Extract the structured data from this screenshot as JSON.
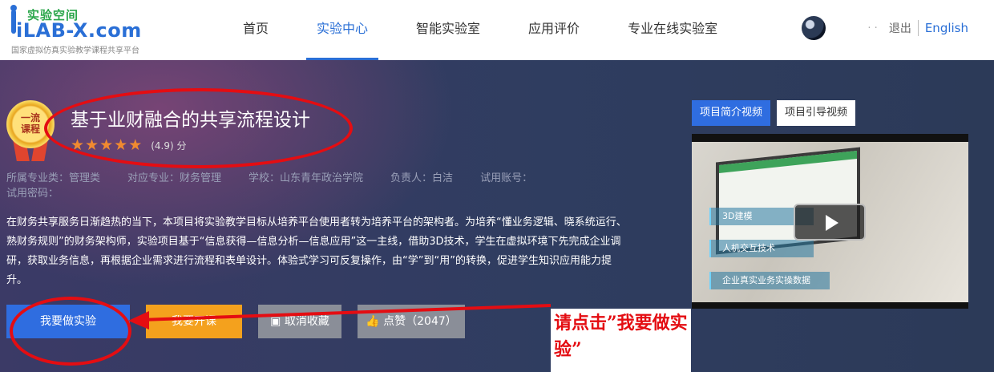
{
  "header": {
    "logo": {
      "cn": "实验空间",
      "en": "iLAB-X.com",
      "subtitle": "国家虚拟仿真实验教学课程共享平台"
    },
    "nav": [
      "首页",
      "实验中心",
      "智能实验室",
      "应用评价",
      "专业在线实验室"
    ],
    "active_nav": "实验中心",
    "user": {
      "name": "· ·",
      "logout": "退出",
      "language": "English"
    }
  },
  "project": {
    "badge": [
      "一流",
      "课程"
    ],
    "title": "基于业财融合的共享流程设计",
    "stars": 5,
    "rating": "(4.9) 分",
    "meta": {
      "category": "所属专业类：管理类",
      "major": "对应专业：财务管理",
      "school": "学校：山东青年政治学院",
      "owner": "负责人：白洁",
      "trial_account": "试用账号：",
      "trial_password": "试用密码："
    },
    "description": "在财务共享服务日渐趋热的当下，本项目将实验教学目标从培养平台使用者转为培养平台的架构者。为培养“懂业务逻辑、晓系统运行、熟财务规则”的财务架构师，实验项目基于“信息获得—信息分析—信息应用”这一主线，借助3D技术，学生在虚拟环境下先完成企业调研，获取业务信息，再根据企业需求进行流程和表单设计。体验式学习可反复操作，由“学”到“用”的转换，促进学生知识应用能力提升。",
    "buttons": {
      "do_experiment": "我要做实验",
      "open_course": "我要开课",
      "unfavorite": "取消收藏",
      "like": "点赞（2047）"
    }
  },
  "video": {
    "tabs": [
      "项目简介视频",
      "项目引导视频"
    ],
    "active_tab": "项目简介视频",
    "features": [
      "3D建模",
      "人机交互技术",
      "企业真实业务实操数据"
    ]
  },
  "annotation": {
    "callout": "请点击”我要做实验”",
    "color": "#e40d12"
  }
}
